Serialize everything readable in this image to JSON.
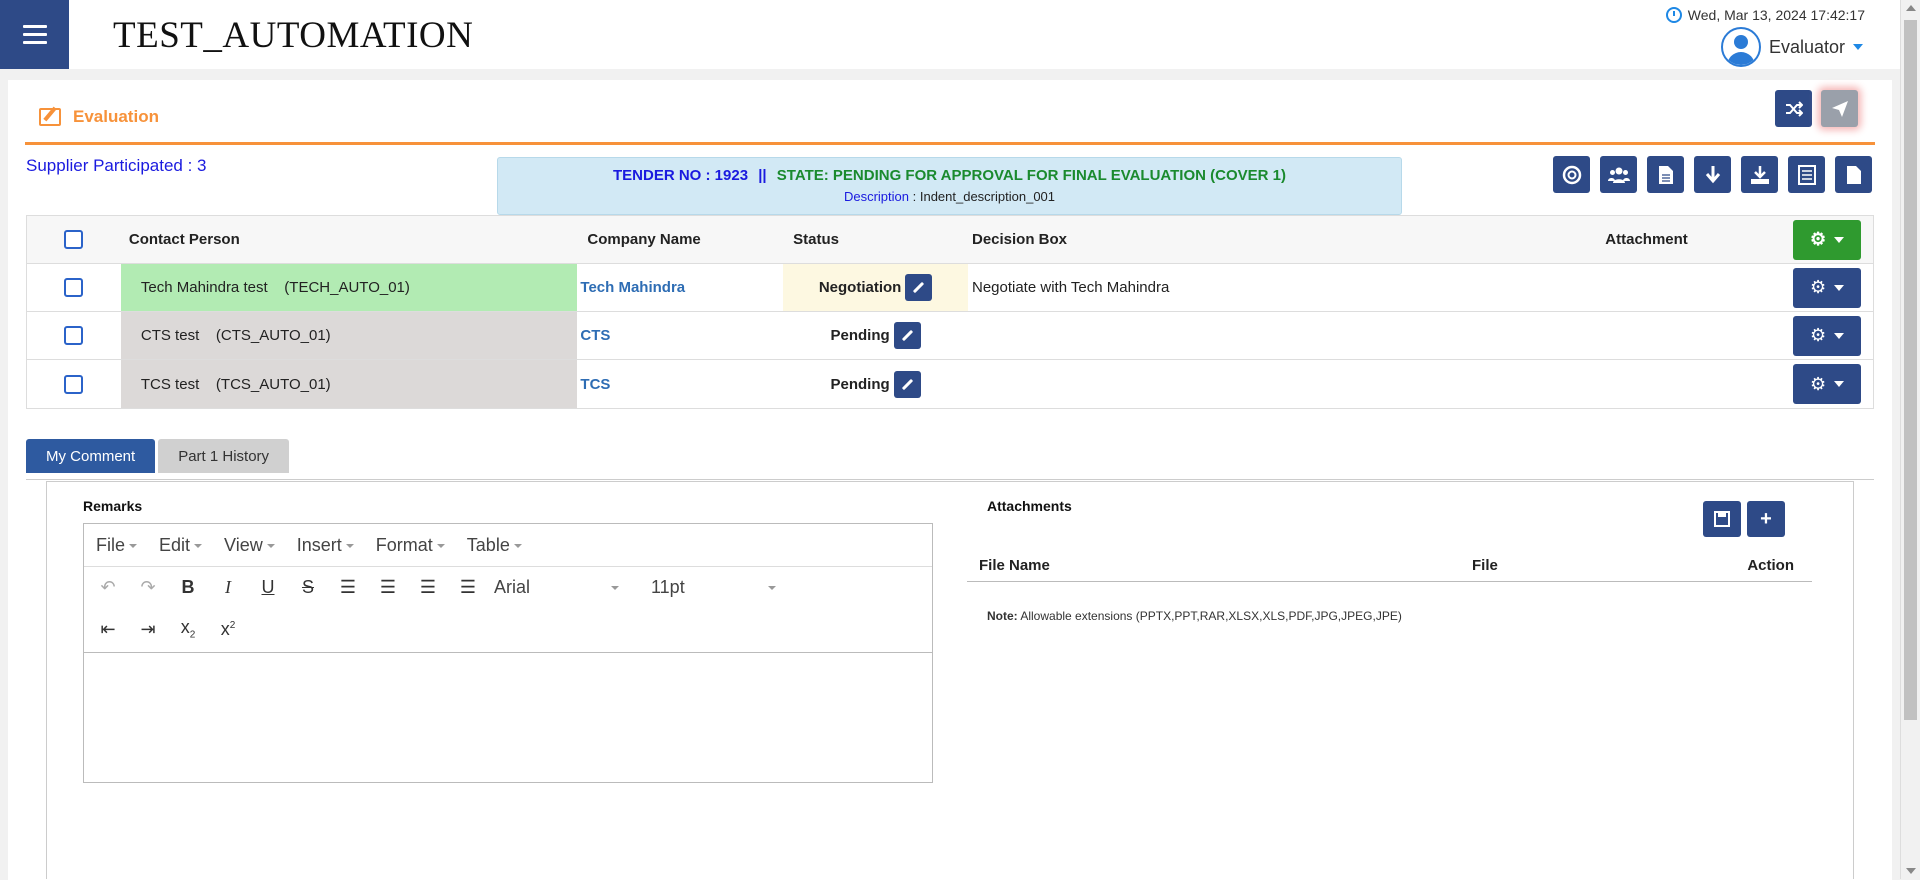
{
  "header": {
    "app_title": "TEST_AUTOMATION",
    "datetime": "Wed, Mar 13, 2024 17:42:17",
    "user_role": "Evaluator"
  },
  "evaluation": {
    "title": "Evaluation",
    "supplier_participated": "Supplier Participated : 3",
    "tender_label": "TENDER NO : 1923",
    "separator": "||",
    "state": "STATE: PENDING FOR APPROVAL FOR FINAL EVALUATION (COVER 1)",
    "description_label": "Description",
    "description_value": ": Indent_description_001"
  },
  "table": {
    "headers": [
      "Contact Person",
      "Company Name",
      "Status",
      "Decision Box",
      "Attachment"
    ],
    "rows": [
      {
        "contact": "Tech Mahindra test    (TECH_AUTO_01)",
        "company": "Tech Mahindra",
        "status": "Negotiation",
        "decision": "Negotiate with Tech Mahindra"
      },
      {
        "contact": "CTS test    (CTS_AUTO_01)",
        "company": "CTS",
        "status": "Pending",
        "decision": ""
      },
      {
        "contact": "TCS test    (TCS_AUTO_01)",
        "company": "TCS",
        "status": "Pending",
        "decision": ""
      }
    ]
  },
  "tabs": [
    "My Comment",
    "Part 1 History"
  ],
  "remarks": {
    "label": "Remarks",
    "menu": [
      "File",
      "Edit",
      "View",
      "Insert",
      "Format",
      "Table"
    ],
    "font": "Arial",
    "size": "11pt"
  },
  "attachments": {
    "label": "Attachments",
    "headers": [
      "File Name",
      "File",
      "Action"
    ],
    "note_label": "Note:",
    "note_text": "Allowable extensions (PPTX,PPT,RAR,XLSX,XLS,PDF,JPG,JPEG,JPE)"
  },
  "colors": {
    "primary": "#2e4a87",
    "accent": "#f7923a",
    "success": "#2f9a2f",
    "row_green": "#b2ebb3",
    "row_grey": "#dcd9d8",
    "status_bg": "#fdf8e1"
  },
  "icons": [
    "menu-icon",
    "clock-icon",
    "user-avatar-icon",
    "edit-icon",
    "shuffle-icon",
    "send-icon",
    "lifebuoy-icon",
    "users-icon",
    "document-icon",
    "download-icon",
    "save-icon",
    "gear-icon",
    "pencil-icon",
    "plus-icon"
  ]
}
